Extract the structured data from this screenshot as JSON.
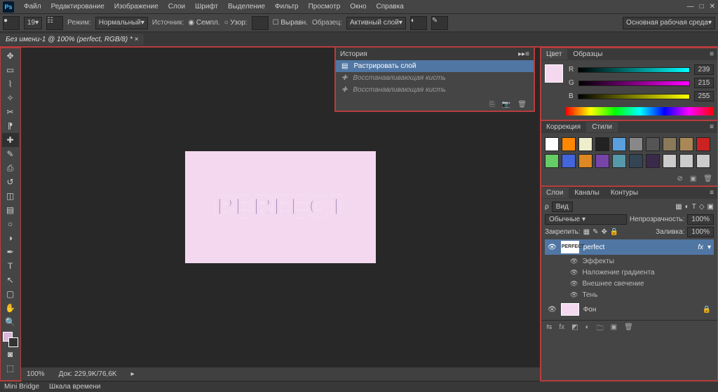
{
  "app": {
    "logo": "Ps"
  },
  "menu": [
    "Файл",
    "Редактирование",
    "Изображение",
    "Слои",
    "Шрифт",
    "Выделение",
    "Фильтр",
    "Просмотр",
    "Окно",
    "Справка"
  ],
  "workspace": "Основная рабочая среда",
  "options": {
    "brush_size": "19",
    "mode_label": "Режим:",
    "mode_value": "Нормальный",
    "source_label": "Источник:",
    "sampled": "Семпл.",
    "pattern": "Узор:",
    "aligned": "Выравн.",
    "sample_label": "Образец:",
    "sample_value": "Активный слой"
  },
  "doc_tab": "Без имени-1 @ 100% (perfect, RGB/8) *",
  "canvas_text": "PERFECT",
  "history": {
    "title": "История",
    "rows": [
      {
        "label": "Растрировать слой",
        "sel": true
      },
      {
        "label": "Восстанавливающая кисть",
        "sel": false
      },
      {
        "label": "Восстанавливающая кисть",
        "sel": false
      }
    ]
  },
  "color": {
    "tab1": "Цвет",
    "tab2": "Образцы",
    "r": "239",
    "g": "215",
    "b": "255",
    "rl": "R",
    "gl": "G",
    "bl": "B"
  },
  "styles": {
    "tab1": "Коррекция",
    "tab2": "Стили"
  },
  "layers": {
    "tab1": "Слои",
    "tab2": "Каналы",
    "tab3": "Контуры",
    "kind": "Вид",
    "blend": "Обычные",
    "opacity_label": "Непрозрачность:",
    "opacity": "100%",
    "lock_label": "Закрепить:",
    "fill_label": "Заливка:",
    "fill": "100%",
    "layer1": "perfect",
    "fx": "fx",
    "effects": "Эффекты",
    "grad": "Наложение градиента",
    "glow": "Внешнее свечение",
    "shadow": "Тень",
    "bg": "Фон"
  },
  "status": {
    "zoom": "100%",
    "docinfo": "Док: 229,9K/76,6K"
  },
  "bottom": {
    "mb": "Mini Bridge",
    "tl": "Шкала времени"
  },
  "style_colors": [
    "#fff",
    "#ff8800",
    "#eeeecc",
    "#222",
    "#5aa0dd",
    "#888",
    "#555",
    "#8a7a5a",
    "#aa8855",
    "#cc2222",
    "#66cc66",
    "#4466dd",
    "#dd8822",
    "#7744aa",
    "#5599aa",
    "#334455",
    "#3a2a4a",
    "#ccc",
    "#ccc",
    "#ccc"
  ]
}
